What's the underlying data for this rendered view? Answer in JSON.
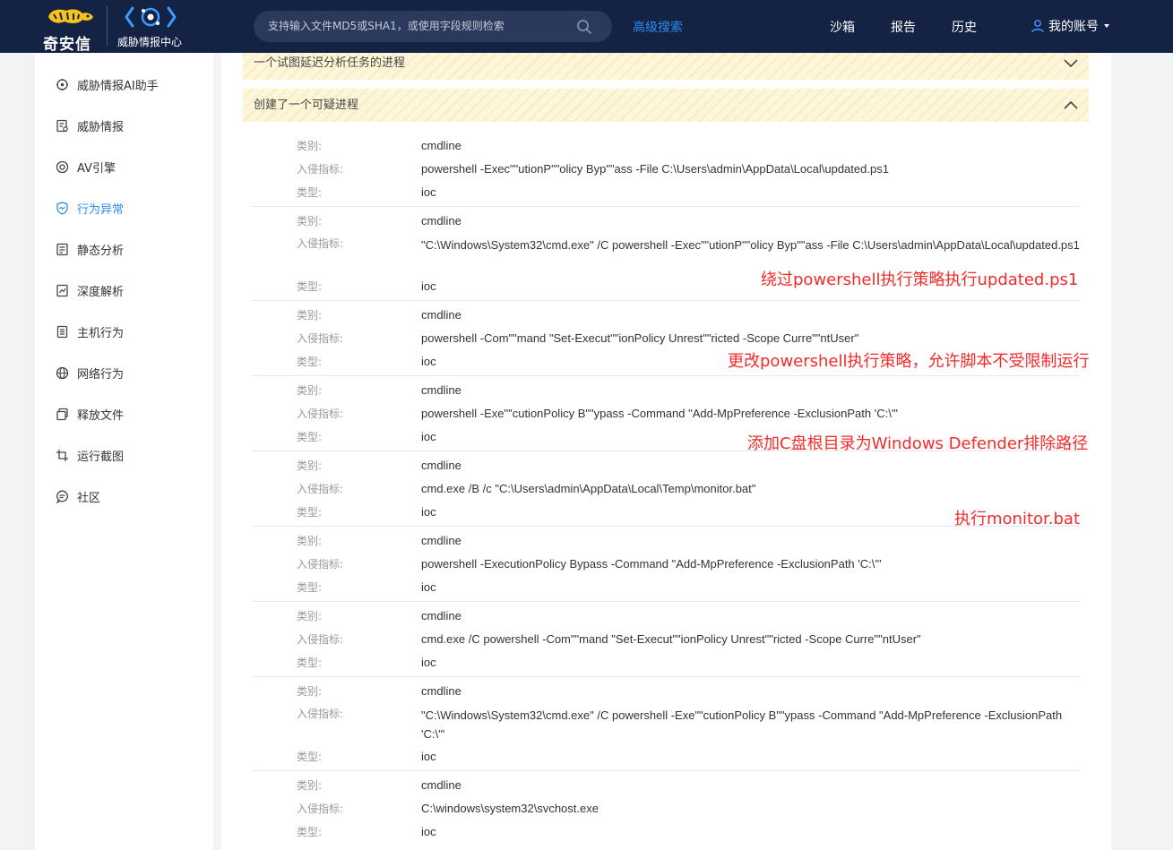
{
  "header": {
    "logo_text": "奇安信",
    "ti_logo_text": "威胁情报中心",
    "search_placeholder": "支持输入文件MD5或SHA1，或使用字段规则检索",
    "advanced_search": "高级搜索",
    "nav": [
      "沙箱",
      "报告",
      "历史"
    ],
    "account": "我的账号"
  },
  "sidebar": {
    "items": [
      {
        "label": "威胁情报AI助手",
        "icon": "ai-assistant-icon"
      },
      {
        "label": "威胁情报",
        "icon": "threat-intel-icon"
      },
      {
        "label": "AV引擎",
        "icon": "av-engine-icon"
      },
      {
        "label": "行为异常",
        "icon": "behavior-anomaly-icon",
        "active": true
      },
      {
        "label": "静态分析",
        "icon": "static-analysis-icon"
      },
      {
        "label": "深度解析",
        "icon": "deep-analysis-icon"
      },
      {
        "label": "主机行为",
        "icon": "host-behavior-icon"
      },
      {
        "label": "网络行为",
        "icon": "network-behavior-icon"
      },
      {
        "label": "释放文件",
        "icon": "dropped-files-icon"
      },
      {
        "label": "运行截图",
        "icon": "screenshot-icon"
      },
      {
        "label": "社区",
        "icon": "community-icon"
      }
    ]
  },
  "main": {
    "section_collapsed": "一个试图延迟分析任务的进程",
    "section_expanded": "创建了一个可疑进程",
    "field_labels": {
      "category": "类别:",
      "indicator": "入侵指标:",
      "type": "类型:"
    },
    "records": [
      {
        "category": "cmdline",
        "indicator": "powershell  -Exec\"\"utionP\"\"olicy Byp\"\"ass -File C:\\Users\\admin\\AppData\\Local\\updated.ps1",
        "type": "ioc"
      },
      {
        "category": "cmdline",
        "indicator": "\"C:\\Windows\\System32\\cmd.exe\" /C powershell -Exec\"\"utionP\"\"olicy Byp\"\"ass -File C:\\Users\\admin\\AppData\\Local\\updated.ps1",
        "type": "ioc"
      },
      {
        "category": "cmdline",
        "indicator": "powershell  -Com\"\"mand \"Set-Execut\"\"ionPolicy Unrest\"\"ricted -Scope Curre\"\"ntUser\"",
        "type": "ioc"
      },
      {
        "category": "cmdline",
        "indicator": "powershell  -Exe\"\"cutionPolicy B\"\"ypass -Command \"Add-MpPreference -ExclusionPath 'C:\\'\"",
        "type": "ioc"
      },
      {
        "category": "cmdline",
        "indicator": "cmd.exe /B /c \"C:\\Users\\admin\\AppData\\Local\\Temp\\monitor.bat\"",
        "type": "ioc"
      },
      {
        "category": "cmdline",
        "indicator": "powershell -ExecutionPolicy Bypass -Command \"Add-MpPreference -ExclusionPath 'C:\\'\"",
        "type": "ioc"
      },
      {
        "category": "cmdline",
        "indicator": "cmd.exe /C powershell -Com\"\"mand \"Set-Execut\"\"ionPolicy Unrest\"\"ricted -Scope Curre\"\"ntUser\"",
        "type": "ioc"
      },
      {
        "category": "cmdline",
        "indicator": "\"C:\\Windows\\System32\\cmd.exe\" /C powershell -Exe\"\"cutionPolicy B\"\"ypass -Command \"Add-MpPreference -ExclusionPath 'C:\\'\"",
        "type": "ioc"
      },
      {
        "category": "cmdline",
        "indicator": "C:\\windows\\system32\\svchost.exe",
        "type": "ioc"
      }
    ]
  },
  "annotations": [
    "绕过powershell执行策略执行updated.ps1",
    "更改powershell执行策略，允许脚本不受限制运行",
    "添加C盘根目录为Windows Defender排除路径",
    "执行monitor.bat"
  ],
  "colors": {
    "header_bg": "#142244",
    "accent": "#2d8cf0",
    "annotation": "#f52a2a",
    "hatch_bg": "#fdf6dc"
  }
}
